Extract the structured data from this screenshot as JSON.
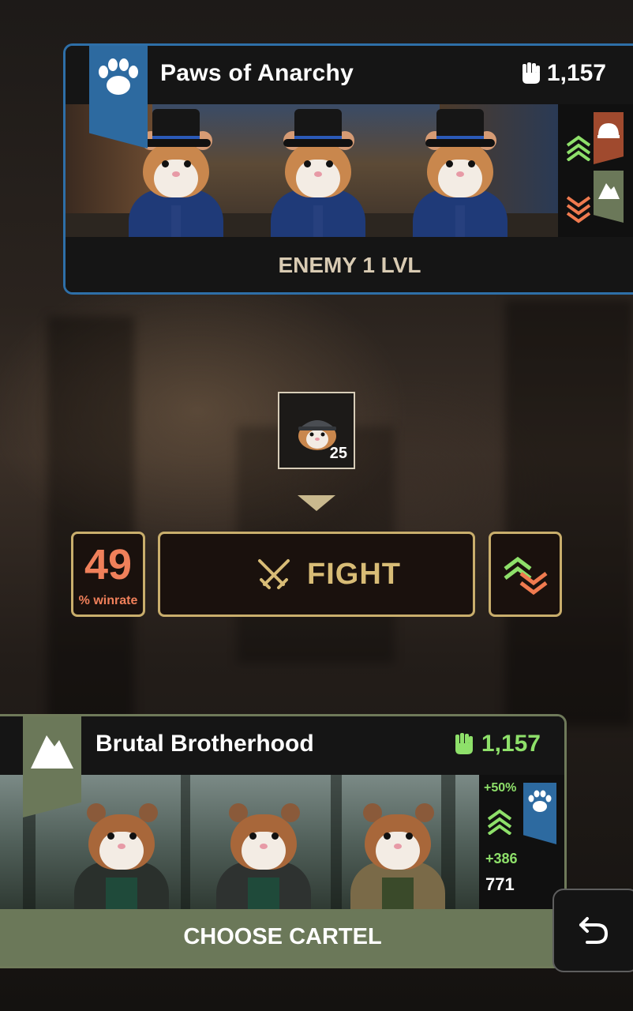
{
  "enemy": {
    "name": "Paws of Anarchy",
    "power": "1,157",
    "level_label": "ENEMY 1 LVL",
    "banner_icon": "paw-icon",
    "strength_icon": "helmet-icon",
    "weakness_icon": "mountain-icon"
  },
  "recruit": {
    "count": "25"
  },
  "battle": {
    "winrate_value": "49",
    "winrate_label": "% winrate",
    "fight_label": "FIGHT"
  },
  "player": {
    "name": "Brutal Brotherhood",
    "power": "1,157",
    "bonus_percent": "+50%",
    "bonus_plus": "+386",
    "total": "771",
    "choose_label": "CHOOSE CARTEL",
    "banner_icon": "mountain-icon",
    "advantage_icon": "paw-icon"
  },
  "colors": {
    "enemy_accent": "#2d6aa0",
    "player_accent": "#6b7859",
    "fight_gold": "#d8bc76",
    "up_green": "#8ee06a",
    "down_orange": "#ef7a4f"
  }
}
